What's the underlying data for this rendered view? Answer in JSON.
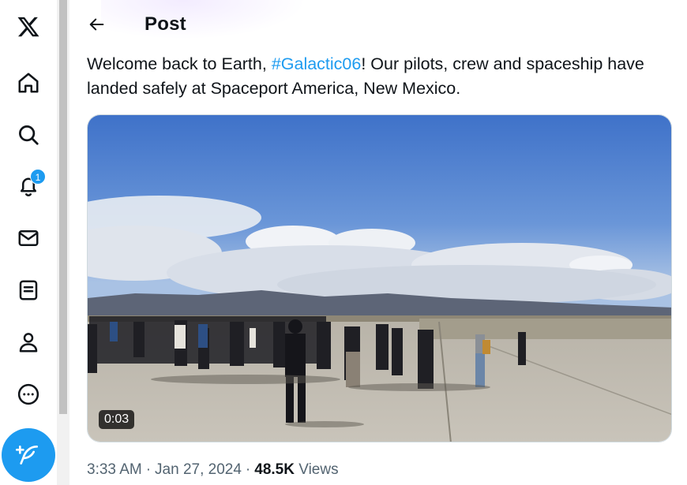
{
  "nav": {
    "items": [
      {
        "name": "x-logo-icon"
      },
      {
        "name": "home-icon"
      },
      {
        "name": "search-icon"
      },
      {
        "name": "notifications-icon",
        "badge": "1"
      },
      {
        "name": "messages-icon"
      },
      {
        "name": "lists-icon"
      },
      {
        "name": "profile-icon"
      },
      {
        "name": "more-icon"
      }
    ],
    "compose_icon": "feather-plus-icon",
    "accent": "#1d9bf0"
  },
  "header": {
    "title": "Post",
    "back_icon": "arrow-left-icon"
  },
  "tweet": {
    "text_before": "Welcome back to Earth, ",
    "hashtag": "#Galactic06",
    "text_after": "! Our pilots, crew and spaceship have landed safely at Spaceport America, New Mexico.",
    "media": {
      "type": "video",
      "duration": "0:03"
    },
    "time": "3:33 AM",
    "date": "Jan 27, 2024",
    "separator": "·",
    "views_count": "48.5K",
    "views_label": "Views"
  }
}
